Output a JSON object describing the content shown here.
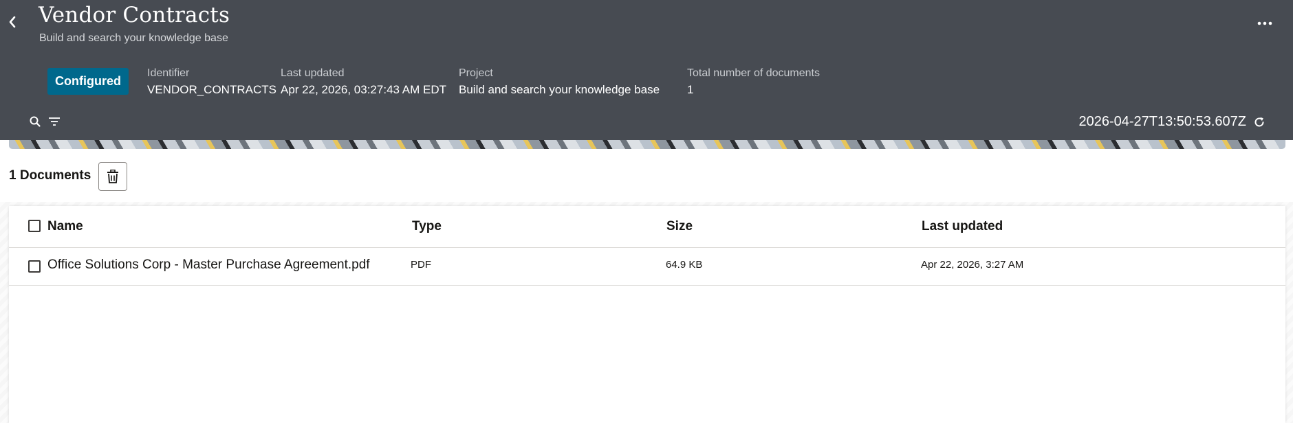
{
  "header": {
    "title": "Vendor Contracts",
    "subtitle": "Build and search your knowledge base",
    "status": "Configured",
    "meta": [
      {
        "label": "Identifier",
        "value": "VENDOR_CONTRACTS"
      },
      {
        "label": "Last updated",
        "value": "Apr 22, 2026, 03:27:43 AM EDT"
      },
      {
        "label": "Project",
        "value": "Build and search your knowledge base"
      },
      {
        "label": "Total number of documents",
        "value": "1"
      }
    ],
    "timestamp": "2026-04-27T13:50:53.607Z"
  },
  "documents": {
    "count_label": "1 Documents"
  },
  "table": {
    "columns": [
      "Name",
      "Type",
      "Size",
      "Last updated"
    ],
    "rows": [
      {
        "name": "Office Solutions Corp - Master Purchase Agreement.pdf",
        "type": "PDF",
        "size": "64.9 KB",
        "last_updated": "Apr 22, 2026, 3:27 AM"
      }
    ]
  },
  "colors": {
    "header_bg": "#474b52",
    "status_badge": "#00688c"
  },
  "icons": {
    "back": "chevron-left-icon",
    "more": "more-horizontal-icon",
    "search": "search-icon",
    "filter": "filter-icon",
    "refresh": "refresh-icon",
    "delete": "trash-icon"
  }
}
